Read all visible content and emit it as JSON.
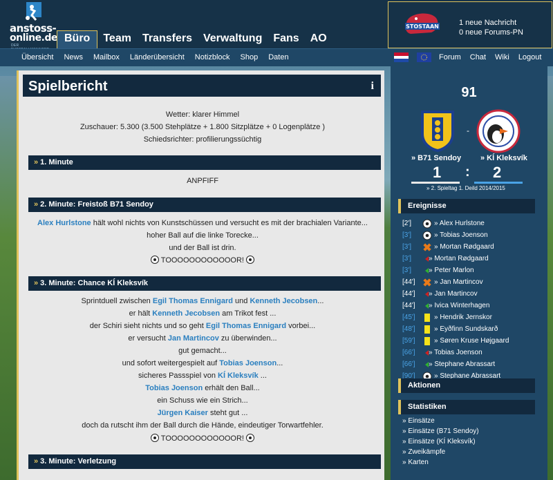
{
  "logo": {
    "line1": "anstoss-",
    "line2": "online.de",
    "line3": "DER FUSSBALLMANAGER"
  },
  "mainnav": [
    "Büro",
    "Team",
    "Transfers",
    "Verwaltung",
    "Fans",
    "AO"
  ],
  "subnav": [
    "Übersicht",
    "News",
    "Mailbox",
    "Länderübersicht",
    "Notizblock",
    "Shop",
    "Daten"
  ],
  "rightnav": [
    "Forum",
    "Chat",
    "Wiki",
    "Logout"
  ],
  "userbox": {
    "club_logo": "STOSTAAN",
    "msg": "1 neue Nachricht",
    "forum": "0 neue Forums-PN"
  },
  "report": {
    "title": "Spielbericht",
    "info": "i",
    "weather": "Wetter: klarer Himmel",
    "spectators": "Zuschauer: 5.300 (3.500 Stehplätze + 1.800 Sitzplätze + 0 Logenplätze )",
    "referee": "Schiedsrichter: profilierungssüchtig",
    "sec1": "1. Minute",
    "kickoff": "ANPFIFF",
    "sec2": "2. Minute: Freistoß B71 Sendoy",
    "s2": {
      "p1": "Alex Hurlstone",
      "l1": " hält wohl nichts von Kunstschüssen und versucht es mit der brachialen Variante...",
      "l2": "hoher Ball auf die linke Torecke...",
      "l3": "und der Ball ist drin.",
      "goal": " TOOOOOOOOOOOOR! "
    },
    "sec3": "3. Minute: Chance KÍ Kleksvík",
    "s3": {
      "a1": "Sprintduell zwischen ",
      "a2": "Egil Thomas Ennigard",
      "a3": " und ",
      "a4": "Kenneth Jecobsen",
      "a5": "...",
      "b1": "er hält ",
      "b2": "Kenneth Jecobsen",
      "b3": " am Trikot fest ...",
      "c1": "der Schiri sieht nichts und so geht ",
      "c2": "Egil Thomas Ennigard",
      "c3": " vorbei...",
      "d1": "er versucht ",
      "d2": "Jan Martincov",
      "d3": " zu überwinden...",
      "e1": "gut gemacht...",
      "f1": "und sofort weitergespielt auf ",
      "f2": "Tobias Joenson",
      "f3": "...",
      "g1": "sicheres Passspiel von ",
      "g2": "KÍ Kleksvík",
      "g3": " ...",
      "h1": "Tobias Joenson",
      "h2": " erhält den Ball...",
      "i1": "ein Schuss wie ein Strich...",
      "j1": "Jürgen Kaiser",
      "j2": " steht gut ...",
      "k1": "doch da rutscht ihm der Ball durch die Hände, eindeutiger Torwartfehler.",
      "goal": " TOOOOOOOOOOOOR! "
    },
    "sec4": "3. Minute: Verletzung"
  },
  "match": {
    "minute": "91",
    "home": "» B71 Sendoy",
    "away": "» KÍ Kleksvík",
    "home_score": "1",
    "colon": ":",
    "away_score": "2",
    "dash": "-",
    "matchday": "» 2. Spieltag 1. Deild 2014/2015"
  },
  "sections": {
    "events": "Ereignisse",
    "actions": "Aktionen",
    "stats": "Statistiken"
  },
  "events": [
    {
      "min": "[2']",
      "icon": "ball-icon",
      "name": "» Alex Hurlstone",
      "color": "#ffffff"
    },
    {
      "min": "[3']",
      "icon": "ball-icon",
      "name": "» Tobias Joenson",
      "color": "#4aa3e6"
    },
    {
      "min": "[3']",
      "icon": "injury-icon",
      "name": "» Mortan Rødgaard",
      "color": "#4aa3e6"
    },
    {
      "min": "[3']",
      "icon": "sub-out-icon",
      "name": "» Mortan Rødgaard",
      "color": "#4aa3e6"
    },
    {
      "min": "[3']",
      "icon": "sub-in-icon",
      "name": "» Peter Marlon",
      "color": "#4aa3e6"
    },
    {
      "min": "[44']",
      "icon": "injury-icon",
      "name": "» Jan Martincov",
      "color": "#ffffff"
    },
    {
      "min": "[44']",
      "icon": "sub-out-icon",
      "name": "» Jan Martincov",
      "color": "#ffffff"
    },
    {
      "min": "[44']",
      "icon": "sub-in-icon",
      "name": "» Ivica Winterhagen",
      "color": "#ffffff"
    },
    {
      "min": "[45']",
      "icon": "yellow-card-icon",
      "name": "» Hendrik Jernskor",
      "color": "#4aa3e6"
    },
    {
      "min": "[48']",
      "icon": "yellow-card-icon",
      "name": "» Eyðfinn Sundskarð",
      "color": "#4aa3e6"
    },
    {
      "min": "[59']",
      "icon": "yellow-card-icon",
      "name": "» Søren Kruse Højgaard",
      "color": "#4aa3e6"
    },
    {
      "min": "[66']",
      "icon": "sub-out-icon",
      "name": "» Tobias Joenson",
      "color": "#4aa3e6"
    },
    {
      "min": "[66']",
      "icon": "sub-in-icon",
      "name": "» Stephane Abrassart",
      "color": "#4aa3e6"
    },
    {
      "min": "[90']",
      "icon": "ball-icon",
      "name": "» Stephane Abrassart",
      "color": "#4aa3e6"
    }
  ],
  "stats": [
    "» Einsätze",
    "» Einsätze (B71 Sendoy)",
    "» Einsätze (KÍ Kleksvík)",
    "» Zweikämpfe",
    "» Karten"
  ],
  "colors": {
    "accent": "#e0c35c",
    "navy": "#12293e",
    "link": "#2a7fbf",
    "panel": "#e8e8e8"
  }
}
